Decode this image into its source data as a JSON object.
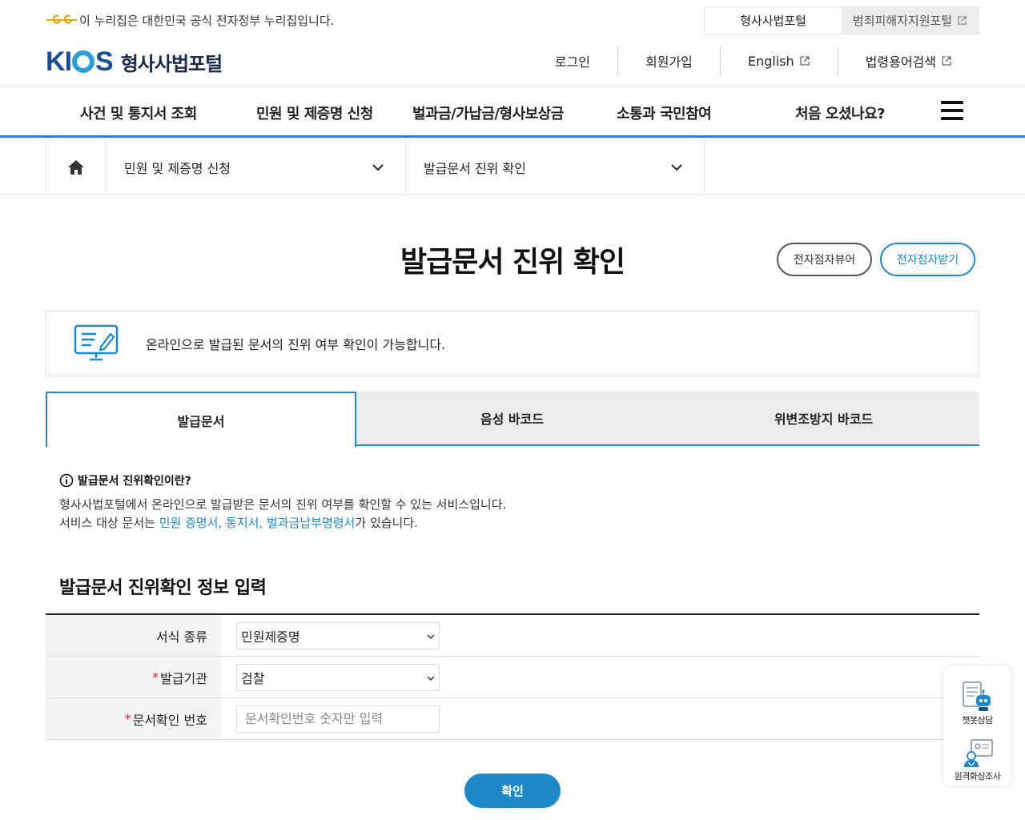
{
  "gov_strip": {
    "notice": "이 누리집은 대한민국 공식 전자정부 누리집입니다.",
    "tabs": [
      {
        "label": "형사사법포털"
      },
      {
        "label": "범죄피해자지원포털"
      }
    ]
  },
  "header": {
    "brand_name": "형사사법포털",
    "logo_letters": [
      "K",
      "I",
      "S"
    ],
    "util_nav": [
      {
        "label": "로그인"
      },
      {
        "label": "회원가입"
      },
      {
        "label": "English"
      },
      {
        "label": "법령용어검색"
      }
    ]
  },
  "gnb": {
    "items": [
      {
        "label": "사건 및 통지서 조회"
      },
      {
        "label": "민원 및 제증명 신청"
      },
      {
        "label": "벌과금/가납금/형사보상금"
      },
      {
        "label": "소통과 국민참여"
      },
      {
        "label": "처음 오셨나요?"
      }
    ]
  },
  "breadcrumb": {
    "level1": "민원 및 제증명 신청",
    "level2": "발급문서 진위 확인"
  },
  "page": {
    "title": "발급문서 진위 확인",
    "viewer_button": "전자점자뷰어",
    "receive_button": "전자점자받기",
    "info_text": "온라인으로 발급된 문서의 진위 여부 확인이 가능합니다."
  },
  "tabs": [
    {
      "label": "발급문서"
    },
    {
      "label": "음성 바코드"
    },
    {
      "label": "위변조방지 바코드"
    }
  ],
  "description": {
    "heading": "발급문서 진위확인이란?",
    "line1": "형사사법포털에서 온라인으로 발급받은 문서의 진위 여부를 확인할 수 있는 서비스입니다.",
    "line2_prefix": "서비스 대상 문서는 ",
    "line2_highlight": "민원 증명서, 통지서, 벌과금납부명령서",
    "line2_suffix": "가 있습니다."
  },
  "form": {
    "title": "발급문서 진위확인 정보 입력",
    "rows": [
      {
        "label": "서식 종류",
        "required": false,
        "value": "민원제증명"
      },
      {
        "label": "발급기관",
        "required": true,
        "value": "검찰"
      },
      {
        "label": "문서확인 번호",
        "required": true,
        "placeholder": "문서확인번호 숫자만 입력"
      }
    ],
    "submit_label": "확인"
  },
  "floating": {
    "chatbot_label": "챗봇상담",
    "video_label": "원격화상조사"
  },
  "colors": {
    "accent": "#1e88c8",
    "brand_dark": "#1b4d96",
    "required": "#d42020"
  }
}
